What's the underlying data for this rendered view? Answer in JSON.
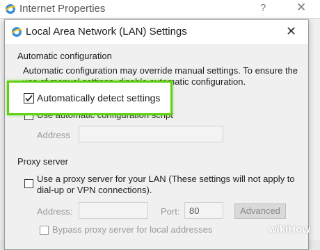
{
  "back_window": {
    "title": "Internet Properties",
    "help": "?",
    "close": "✕"
  },
  "dialog": {
    "title": "Local Area Network (LAN) Settings",
    "close": "✕"
  },
  "automatic_configuration": {
    "group_label": "Automatic configuration",
    "description_line1": "Automatic configuration may override manual settings.  To ensure the",
    "description_line2": "use of manual settings, disable automatic configuration.",
    "auto_detect_label": "Automatically detect settings",
    "auto_detect_checked": true,
    "use_script_label": "Use automatic configuration script",
    "address_label": "Address",
    "address_value": ""
  },
  "proxy_server": {
    "group_label": "Proxy server",
    "use_proxy_label_line1": "Use a proxy server for your LAN (These settings will not apply to",
    "use_proxy_label_line2": "dial-up or VPN connections).",
    "address_label": "Address:",
    "address_value": "",
    "port_label": "Port:",
    "port_value": "80",
    "advanced_label": "Advanced",
    "bypass_label": "Bypass proxy server for local addresses"
  },
  "watermark": {
    "wiki": "wiki",
    "how": "How"
  },
  "colors": {
    "highlight": "#5ed10f"
  }
}
